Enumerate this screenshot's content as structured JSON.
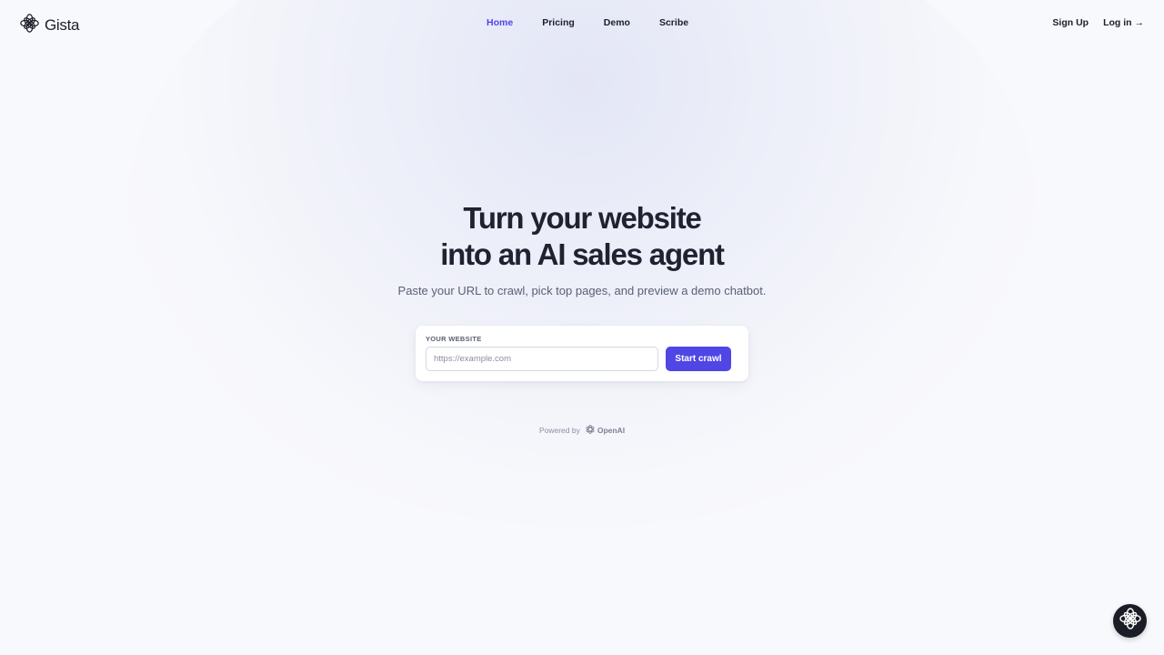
{
  "brand": {
    "name": "Gista",
    "logo_icon": "flower-logo-icon"
  },
  "nav": {
    "items": [
      {
        "label": "Home",
        "active": true
      },
      {
        "label": "Pricing",
        "active": false
      },
      {
        "label": "Demo",
        "active": false
      },
      {
        "label": "Scribe",
        "active": false
      }
    ]
  },
  "auth": {
    "signup_label": "Sign Up",
    "login_label": "Log in →"
  },
  "hero": {
    "title_line1": "Turn your website",
    "title_line2": "into an AI sales agent",
    "subtitle": "Paste your URL to crawl, pick top pages, and preview a demo chatbot."
  },
  "form": {
    "label": "YOUR WEBSITE",
    "input_value": "",
    "input_placeholder": "https://example.com",
    "submit_label": "Start crawl"
  },
  "powered_by": {
    "prefix": "Powered by",
    "provider": "OpenAI",
    "provider_icon": "openai-logo-icon"
  },
  "chat_launcher": {
    "icon": "flower-logo-icon"
  },
  "colors": {
    "accent": "#4f46e5",
    "background": "#f8f9fc",
    "text": "#1c1f2b",
    "muted": "#5b6072",
    "launcher": "#1b1d26"
  }
}
